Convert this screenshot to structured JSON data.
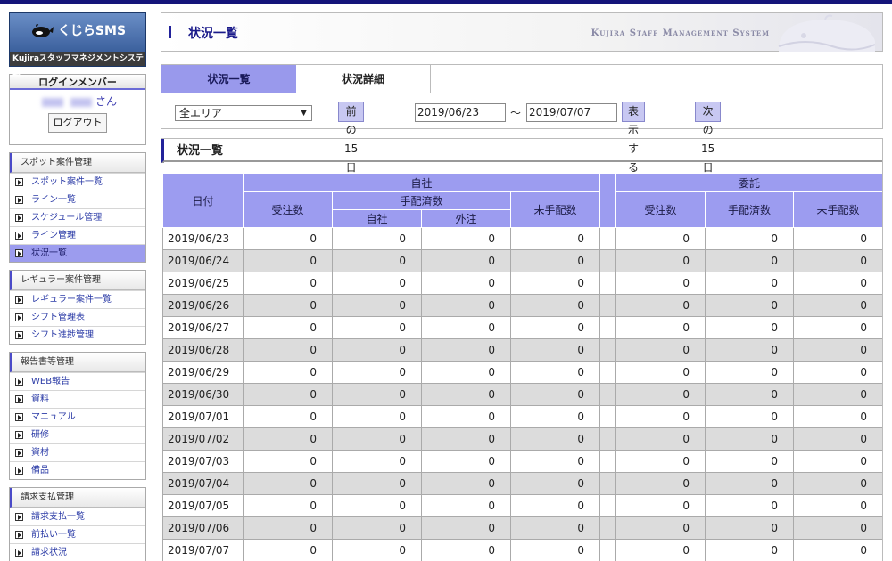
{
  "app": {
    "logo_text": "くじらSMS",
    "logo_subtitle": "Kujiraスタッフマネジメントシステム",
    "page_title": "状況一覧",
    "system_name": "Kujira Staff Management System"
  },
  "login": {
    "title": "ログインメンバー",
    "suffix": "さん",
    "logout_label": "ログアウト"
  },
  "menu": [
    {
      "title": "スポット案件管理",
      "items": [
        {
          "label": "スポット案件一覧",
          "active": false
        },
        {
          "label": "ライン一覧",
          "active": false
        },
        {
          "label": "スケジュール管理",
          "active": false
        },
        {
          "label": "ライン管理",
          "active": false
        },
        {
          "label": "状況一覧",
          "active": true
        }
      ]
    },
    {
      "title": "レギュラー案件管理",
      "items": [
        {
          "label": "レギュラー案件一覧",
          "active": false
        },
        {
          "label": "シフト管理表",
          "active": false
        },
        {
          "label": "シフト進捗管理",
          "active": false
        }
      ]
    },
    {
      "title": "報告書等管理",
      "items": [
        {
          "label": "WEB報告",
          "active": false
        },
        {
          "label": "資料",
          "active": false
        },
        {
          "label": "マニュアル",
          "active": false
        },
        {
          "label": "研修",
          "active": false
        },
        {
          "label": "資材",
          "active": false
        },
        {
          "label": "備品",
          "active": false
        }
      ]
    },
    {
      "title": "請求支払管理",
      "items": [
        {
          "label": "請求支払一覧",
          "active": false
        },
        {
          "label": "前払い一覧",
          "active": false
        },
        {
          "label": "請求状況",
          "active": false
        }
      ]
    }
  ],
  "tabs": [
    "状況一覧",
    "状況詳細"
  ],
  "filter": {
    "area": "全エリア",
    "prev_label": "前の15日",
    "date_from": "2019/06/23",
    "tilde": "～",
    "date_to": "2019/07/07",
    "show_label": "表示する",
    "next_label": "次の15日"
  },
  "panel_title": "状況一覧",
  "table": {
    "date_header": "日付",
    "group_own": "自社",
    "group_outsource": "委託",
    "received": "受注数",
    "arranged": "手配済数",
    "unarranged": "未手配数",
    "sub_own": "自社",
    "sub_outside": "外注",
    "rows": [
      {
        "date": "2019/06/23",
        "v": [
          0,
          0,
          0,
          0,
          0,
          0,
          0
        ]
      },
      {
        "date": "2019/06/24",
        "v": [
          0,
          0,
          0,
          0,
          0,
          0,
          0
        ]
      },
      {
        "date": "2019/06/25",
        "v": [
          0,
          0,
          0,
          0,
          0,
          0,
          0
        ]
      },
      {
        "date": "2019/06/26",
        "v": [
          0,
          0,
          0,
          0,
          0,
          0,
          0
        ]
      },
      {
        "date": "2019/06/27",
        "v": [
          0,
          0,
          0,
          0,
          0,
          0,
          0
        ]
      },
      {
        "date": "2019/06/28",
        "v": [
          0,
          0,
          0,
          0,
          0,
          0,
          0
        ]
      },
      {
        "date": "2019/06/29",
        "v": [
          0,
          0,
          0,
          0,
          0,
          0,
          0
        ]
      },
      {
        "date": "2019/06/30",
        "v": [
          0,
          0,
          0,
          0,
          0,
          0,
          0
        ]
      },
      {
        "date": "2019/07/01",
        "v": [
          0,
          0,
          0,
          0,
          0,
          0,
          0
        ]
      },
      {
        "date": "2019/07/02",
        "v": [
          0,
          0,
          0,
          0,
          0,
          0,
          0
        ]
      },
      {
        "date": "2019/07/03",
        "v": [
          0,
          0,
          0,
          0,
          0,
          0,
          0
        ]
      },
      {
        "date": "2019/07/04",
        "v": [
          0,
          0,
          0,
          0,
          0,
          0,
          0
        ]
      },
      {
        "date": "2019/07/05",
        "v": [
          0,
          0,
          0,
          0,
          0,
          0,
          0
        ]
      },
      {
        "date": "2019/07/06",
        "v": [
          0,
          0,
          0,
          0,
          0,
          0,
          0
        ]
      },
      {
        "date": "2019/07/07",
        "v": [
          0,
          0,
          0,
          0,
          0,
          0,
          0
        ]
      }
    ]
  },
  "colors": {
    "accent": "#9c9cf0",
    "header_accent": "#15157a"
  }
}
